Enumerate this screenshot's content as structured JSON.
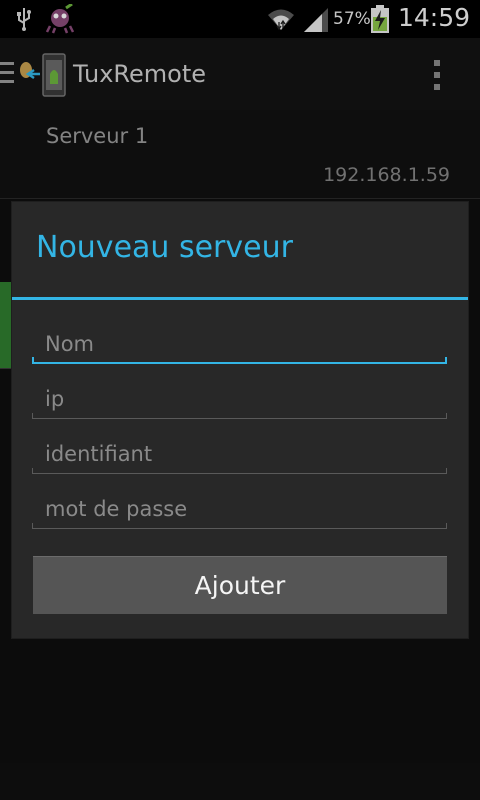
{
  "status_bar": {
    "battery_percent": "57%",
    "time": "14:59",
    "icons": [
      "usb-icon",
      "notification-app-icon",
      "wifi-icon",
      "signal-icon",
      "battery-charging-icon"
    ]
  },
  "action_bar": {
    "title": "TuxRemote",
    "icons": [
      "drawer-icon",
      "app-logo-icon",
      "overflow-menu-icon"
    ]
  },
  "server_list": {
    "items": [
      {
        "name": "Serveur 1",
        "ip": "192.168.1.59"
      }
    ]
  },
  "dialog": {
    "title": "Nouveau serveur",
    "fields": [
      {
        "placeholder": "Nom",
        "value": ""
      },
      {
        "placeholder": "ip",
        "value": ""
      },
      {
        "placeholder": "identifiant",
        "value": ""
      },
      {
        "placeholder": "mot de passe",
        "value": ""
      }
    ],
    "submit_label": "Ajouter"
  },
  "colors": {
    "accent": "#33b5e5",
    "dialog_bg": "#282828",
    "button_bg": "#555555"
  }
}
